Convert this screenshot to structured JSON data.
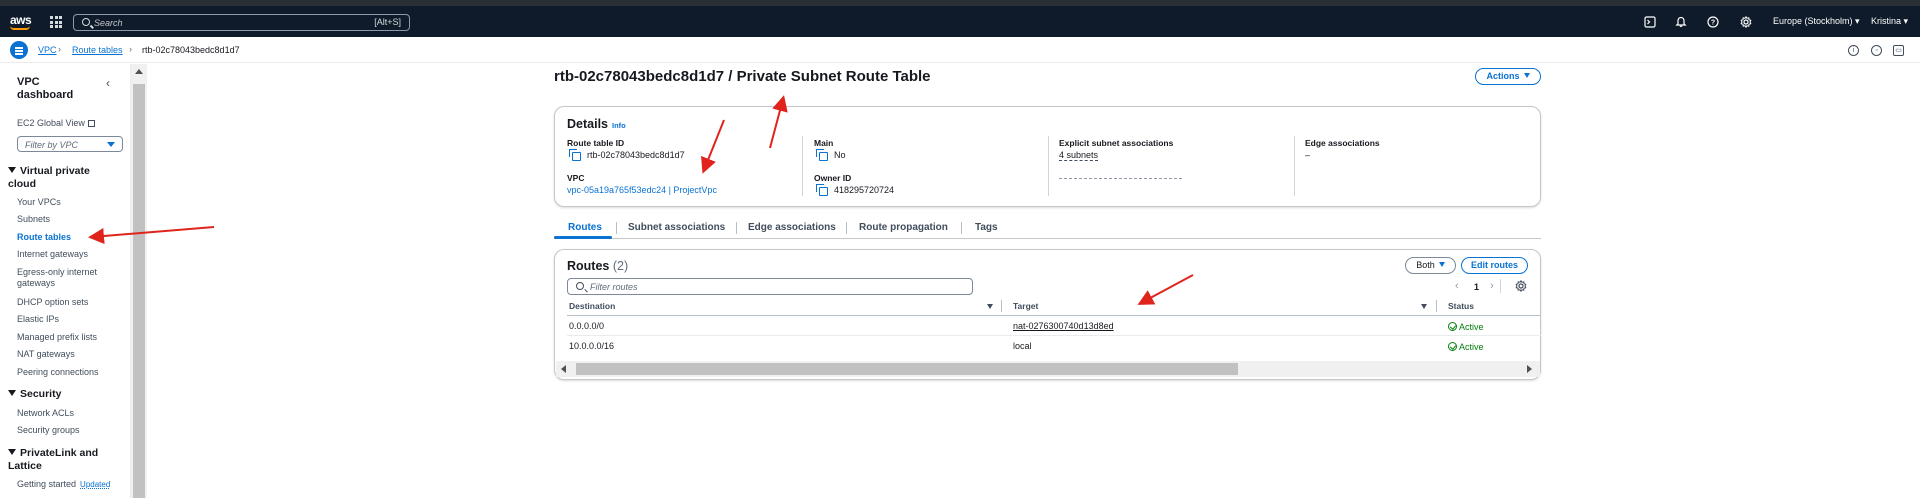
{
  "topnav": {
    "logo": "aws",
    "search_placeholder": "Search",
    "search_shortcut": "[Alt+S]",
    "region": "Europe (Stockholm) ▾",
    "user": "Kristina ▾",
    "icons": [
      "cloudshell-icon",
      "bell-icon",
      "help-icon",
      "gear-icon"
    ]
  },
  "breadcrumb": {
    "items": [
      "VPC",
      "Route tables",
      "rtb-02c78043bedc8d1d7"
    ]
  },
  "sidebar": {
    "title": "VPC\ndashboard",
    "ec2_global_view": "EC2 Global View",
    "filter_placeholder": "Filter by VPC",
    "sections": [
      {
        "title": "Virtual private cloud",
        "items": [
          "Your VPCs",
          "Subnets",
          "Route tables",
          "Internet gateways",
          "Egress-only internet gateways",
          "DHCP option sets",
          "Elastic IPs",
          "Managed prefix lists",
          "NAT gateways",
          "Peering connections"
        ]
      },
      {
        "title": "Security",
        "items": [
          "Network ACLs",
          "Security groups"
        ]
      },
      {
        "title": "PrivateLink and Lattice",
        "items": [
          "Getting started"
        ]
      }
    ],
    "updated_badge": "Updated",
    "active_item": "Route tables"
  },
  "page": {
    "title": "rtb-02c78043bedc8d1d7 / Private Subnet Route Table",
    "actions_label": "Actions"
  },
  "details": {
    "heading": "Details",
    "info": "Info",
    "route_table_id_label": "Route table ID",
    "route_table_id": "rtb-02c78043bedc8d1d7",
    "vpc_label": "VPC",
    "vpc_value": "vpc-05a19a765f53edc24 | ProjectVpc",
    "main_label": "Main",
    "main_value": "No",
    "owner_label": "Owner ID",
    "owner_value": "418295720724",
    "explicit_label": "Explicit subnet associations",
    "explicit_value": "4 subnets",
    "edge_label": "Edge associations",
    "edge_value": "–"
  },
  "tabs": [
    "Routes",
    "Subnet associations",
    "Edge associations",
    "Route propagation",
    "Tags"
  ],
  "routes": {
    "heading": "Routes",
    "count": "(2)",
    "both_label": "Both",
    "edit_label": "Edit routes",
    "filter_placeholder": "Filter routes",
    "page": "1",
    "columns": [
      "Destination",
      "Target",
      "Status"
    ],
    "rows": [
      {
        "destination": "0.0.0.0/0",
        "target": "nat-0276300740d13d8ed",
        "status": "Active"
      },
      {
        "destination": "10.0.0.0/16",
        "target": "local",
        "status": "Active"
      }
    ]
  },
  "colors": {
    "nav_bg": "#0f1b2a",
    "link": "#0972d3",
    "success": "#037f0c",
    "annotation_arrow": "#e0241b"
  }
}
